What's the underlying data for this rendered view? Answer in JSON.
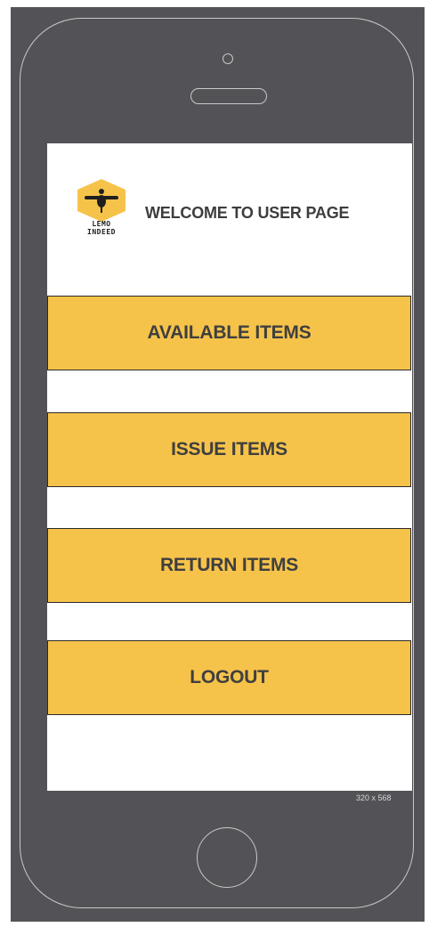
{
  "header": {
    "logo_line1": "LEMO",
    "logo_line2": "INDEED",
    "title": "WELCOME TO USER PAGE"
  },
  "menu": {
    "items": [
      {
        "label": "AVAILABLE ITEMS"
      },
      {
        "label": "ISSUE ITEMS"
      },
      {
        "label": "RETURN ITEMS"
      },
      {
        "label": "LOGOUT"
      }
    ]
  },
  "device": {
    "size_label": "320 x 568"
  },
  "colors": {
    "button_fill": "#f6c34a",
    "phone_body": "#535256",
    "screen_bg": "#ffffff",
    "text": "#3f3f3f"
  },
  "icons": {
    "logo": "lemo-indeed-bee-logo",
    "home": "home-button-icon"
  }
}
